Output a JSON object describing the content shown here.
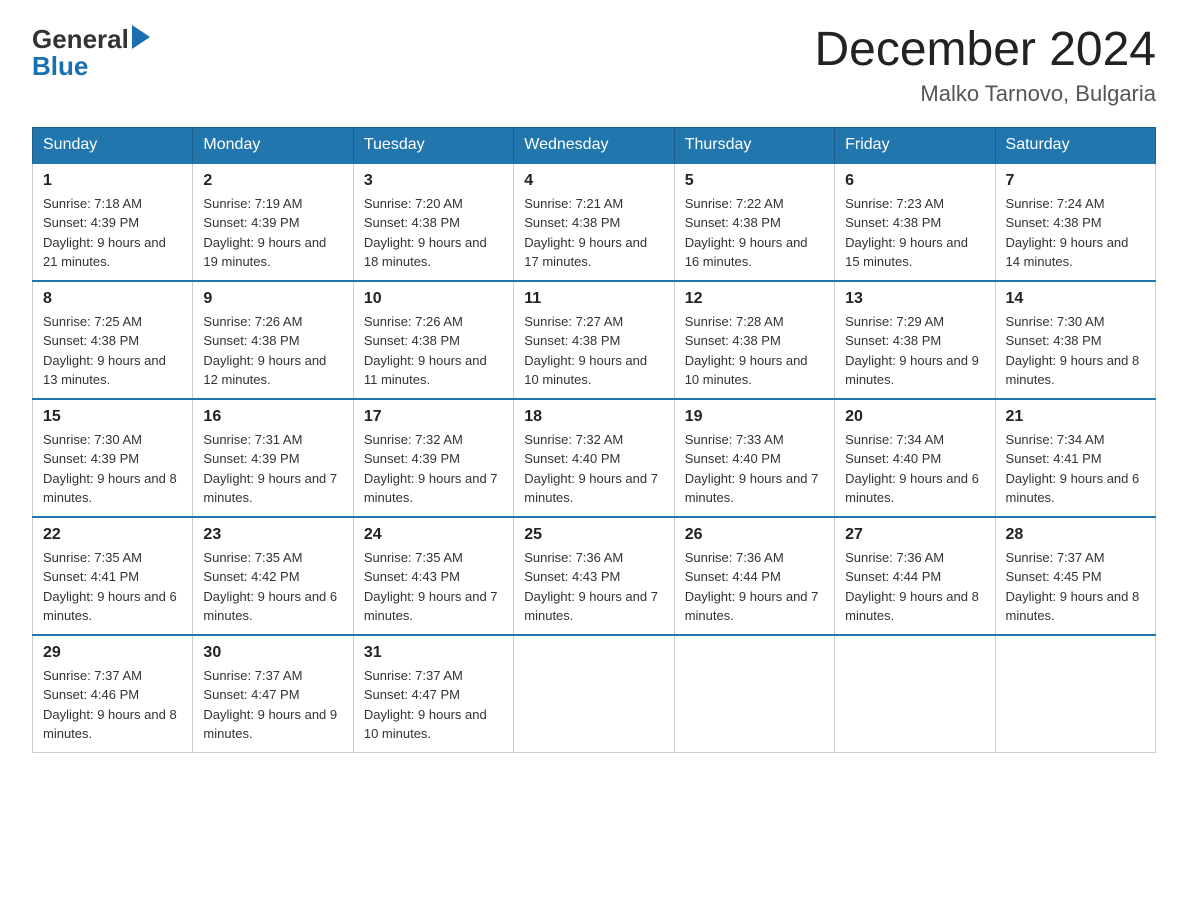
{
  "header": {
    "logo_general": "General",
    "logo_blue": "Blue",
    "month_title": "December 2024",
    "location": "Malko Tarnovo, Bulgaria"
  },
  "calendar": {
    "days_of_week": [
      "Sunday",
      "Monday",
      "Tuesday",
      "Wednesday",
      "Thursday",
      "Friday",
      "Saturday"
    ],
    "weeks": [
      [
        {
          "day": "1",
          "sunrise": "7:18 AM",
          "sunset": "4:39 PM",
          "daylight": "9 hours and 21 minutes."
        },
        {
          "day": "2",
          "sunrise": "7:19 AM",
          "sunset": "4:39 PM",
          "daylight": "9 hours and 19 minutes."
        },
        {
          "day": "3",
          "sunrise": "7:20 AM",
          "sunset": "4:38 PM",
          "daylight": "9 hours and 18 minutes."
        },
        {
          "day": "4",
          "sunrise": "7:21 AM",
          "sunset": "4:38 PM",
          "daylight": "9 hours and 17 minutes."
        },
        {
          "day": "5",
          "sunrise": "7:22 AM",
          "sunset": "4:38 PM",
          "daylight": "9 hours and 16 minutes."
        },
        {
          "day": "6",
          "sunrise": "7:23 AM",
          "sunset": "4:38 PM",
          "daylight": "9 hours and 15 minutes."
        },
        {
          "day": "7",
          "sunrise": "7:24 AM",
          "sunset": "4:38 PM",
          "daylight": "9 hours and 14 minutes."
        }
      ],
      [
        {
          "day": "8",
          "sunrise": "7:25 AM",
          "sunset": "4:38 PM",
          "daylight": "9 hours and 13 minutes."
        },
        {
          "day": "9",
          "sunrise": "7:26 AM",
          "sunset": "4:38 PM",
          "daylight": "9 hours and 12 minutes."
        },
        {
          "day": "10",
          "sunrise": "7:26 AM",
          "sunset": "4:38 PM",
          "daylight": "9 hours and 11 minutes."
        },
        {
          "day": "11",
          "sunrise": "7:27 AM",
          "sunset": "4:38 PM",
          "daylight": "9 hours and 10 minutes."
        },
        {
          "day": "12",
          "sunrise": "7:28 AM",
          "sunset": "4:38 PM",
          "daylight": "9 hours and 10 minutes."
        },
        {
          "day": "13",
          "sunrise": "7:29 AM",
          "sunset": "4:38 PM",
          "daylight": "9 hours and 9 minutes."
        },
        {
          "day": "14",
          "sunrise": "7:30 AM",
          "sunset": "4:38 PM",
          "daylight": "9 hours and 8 minutes."
        }
      ],
      [
        {
          "day": "15",
          "sunrise": "7:30 AM",
          "sunset": "4:39 PM",
          "daylight": "9 hours and 8 minutes."
        },
        {
          "day": "16",
          "sunrise": "7:31 AM",
          "sunset": "4:39 PM",
          "daylight": "9 hours and 7 minutes."
        },
        {
          "day": "17",
          "sunrise": "7:32 AM",
          "sunset": "4:39 PM",
          "daylight": "9 hours and 7 minutes."
        },
        {
          "day": "18",
          "sunrise": "7:32 AM",
          "sunset": "4:40 PM",
          "daylight": "9 hours and 7 minutes."
        },
        {
          "day": "19",
          "sunrise": "7:33 AM",
          "sunset": "4:40 PM",
          "daylight": "9 hours and 7 minutes."
        },
        {
          "day": "20",
          "sunrise": "7:34 AM",
          "sunset": "4:40 PM",
          "daylight": "9 hours and 6 minutes."
        },
        {
          "day": "21",
          "sunrise": "7:34 AM",
          "sunset": "4:41 PM",
          "daylight": "9 hours and 6 minutes."
        }
      ],
      [
        {
          "day": "22",
          "sunrise": "7:35 AM",
          "sunset": "4:41 PM",
          "daylight": "9 hours and 6 minutes."
        },
        {
          "day": "23",
          "sunrise": "7:35 AM",
          "sunset": "4:42 PM",
          "daylight": "9 hours and 6 minutes."
        },
        {
          "day": "24",
          "sunrise": "7:35 AM",
          "sunset": "4:43 PM",
          "daylight": "9 hours and 7 minutes."
        },
        {
          "day": "25",
          "sunrise": "7:36 AM",
          "sunset": "4:43 PM",
          "daylight": "9 hours and 7 minutes."
        },
        {
          "day": "26",
          "sunrise": "7:36 AM",
          "sunset": "4:44 PM",
          "daylight": "9 hours and 7 minutes."
        },
        {
          "day": "27",
          "sunrise": "7:36 AM",
          "sunset": "4:44 PM",
          "daylight": "9 hours and 8 minutes."
        },
        {
          "day": "28",
          "sunrise": "7:37 AM",
          "sunset": "4:45 PM",
          "daylight": "9 hours and 8 minutes."
        }
      ],
      [
        {
          "day": "29",
          "sunrise": "7:37 AM",
          "sunset": "4:46 PM",
          "daylight": "9 hours and 8 minutes."
        },
        {
          "day": "30",
          "sunrise": "7:37 AM",
          "sunset": "4:47 PM",
          "daylight": "9 hours and 9 minutes."
        },
        {
          "day": "31",
          "sunrise": "7:37 AM",
          "sunset": "4:47 PM",
          "daylight": "9 hours and 10 minutes."
        },
        null,
        null,
        null,
        null
      ]
    ]
  }
}
